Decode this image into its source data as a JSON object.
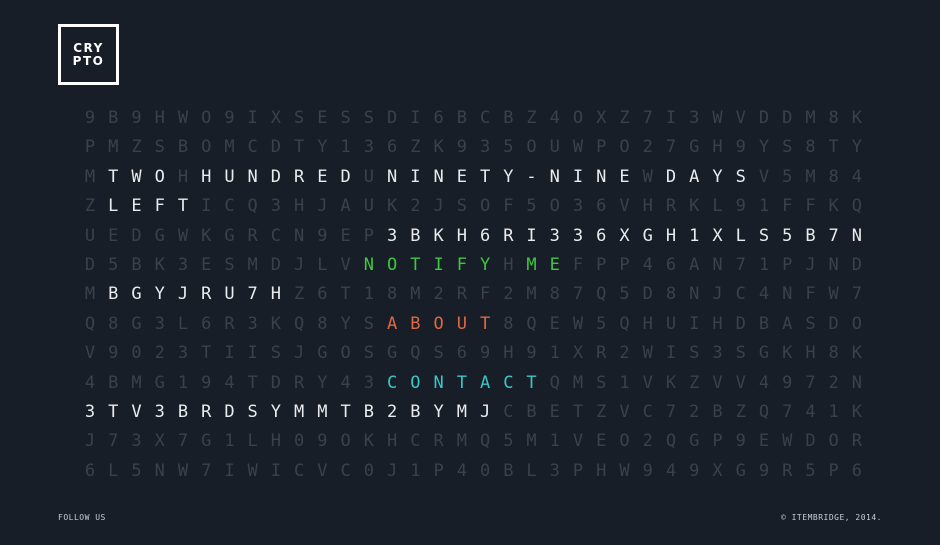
{
  "logo": {
    "line1": "CRY",
    "line2": "PTO"
  },
  "colors": {
    "background": "#181e27",
    "dim_letters": "#3a414b",
    "headline": "#e9ebee",
    "notify": "#3ec83e",
    "about": "#e0683f",
    "contact": "#38c6c6"
  },
  "grid": {
    "rows": [
      "9B9HWO9IXSESSDI6BCBZ4OXZ7I3WVDDM8K",
      "PMZSBOMCDTY136ZK935OUWPO27GH9YS8TY",
      "MTWOHHUNDREDUNINETY-NINEWDAYSV5M84",
      "ZLEFTICQ3HJAUK2JSOF5O36VHRKL91FFKQ",
      "UEDGWKGRCN9EP3BKH6RI336XGH1XLS5B7N",
      "D5BK3ESMDJLVNOTIFYHMEFPP46AN71PJND",
      "MBGYJRU7HZ6T18M2RF2M87Q5D8NJC4NFW7",
      "Q8G3L6R3KQ8YSABOUT8QEW5QHUIHDBASDO",
      "V9023TIISJGOSGQS69H91XR2WIS3SGKH8K",
      "4BMG194TDRY43CONTACTQMS1VKZVV4972N",
      "3TV3BRDSYMMTB2BYMJCBETZVC72BZQ741K",
      "J73X7G1LH09OKHCRMQ5M1VEO2QGP9EWDOR",
      "6L5NW7IWICVC0J1P40BL3PHW949XG9R5P6"
    ],
    "highlights": [
      {
        "row": 2,
        "from": 1,
        "to": 3,
        "color": "white"
      },
      {
        "row": 2,
        "from": 5,
        "to": 11,
        "color": "white"
      },
      {
        "row": 2,
        "from": 13,
        "to": 23,
        "color": "white"
      },
      {
        "row": 2,
        "from": 25,
        "to": 28,
        "color": "white"
      },
      {
        "row": 3,
        "from": 1,
        "to": 4,
        "color": "white"
      },
      {
        "row": 4,
        "from": 13,
        "to": 33,
        "color": "white"
      },
      {
        "row": 5,
        "from": 12,
        "to": 17,
        "color": "green"
      },
      {
        "row": 5,
        "from": 19,
        "to": 20,
        "color": "green"
      },
      {
        "row": 6,
        "from": 1,
        "to": 8,
        "color": "white"
      },
      {
        "row": 7,
        "from": 13,
        "to": 17,
        "color": "orange"
      },
      {
        "row": 9,
        "from": 13,
        "to": 19,
        "color": "cyan"
      },
      {
        "row": 10,
        "from": 0,
        "to": 17,
        "color": "white"
      }
    ]
  },
  "footer": {
    "follow": "FOLLOW US",
    "copyright": "© ITEMBRIDGE, 2014."
  }
}
